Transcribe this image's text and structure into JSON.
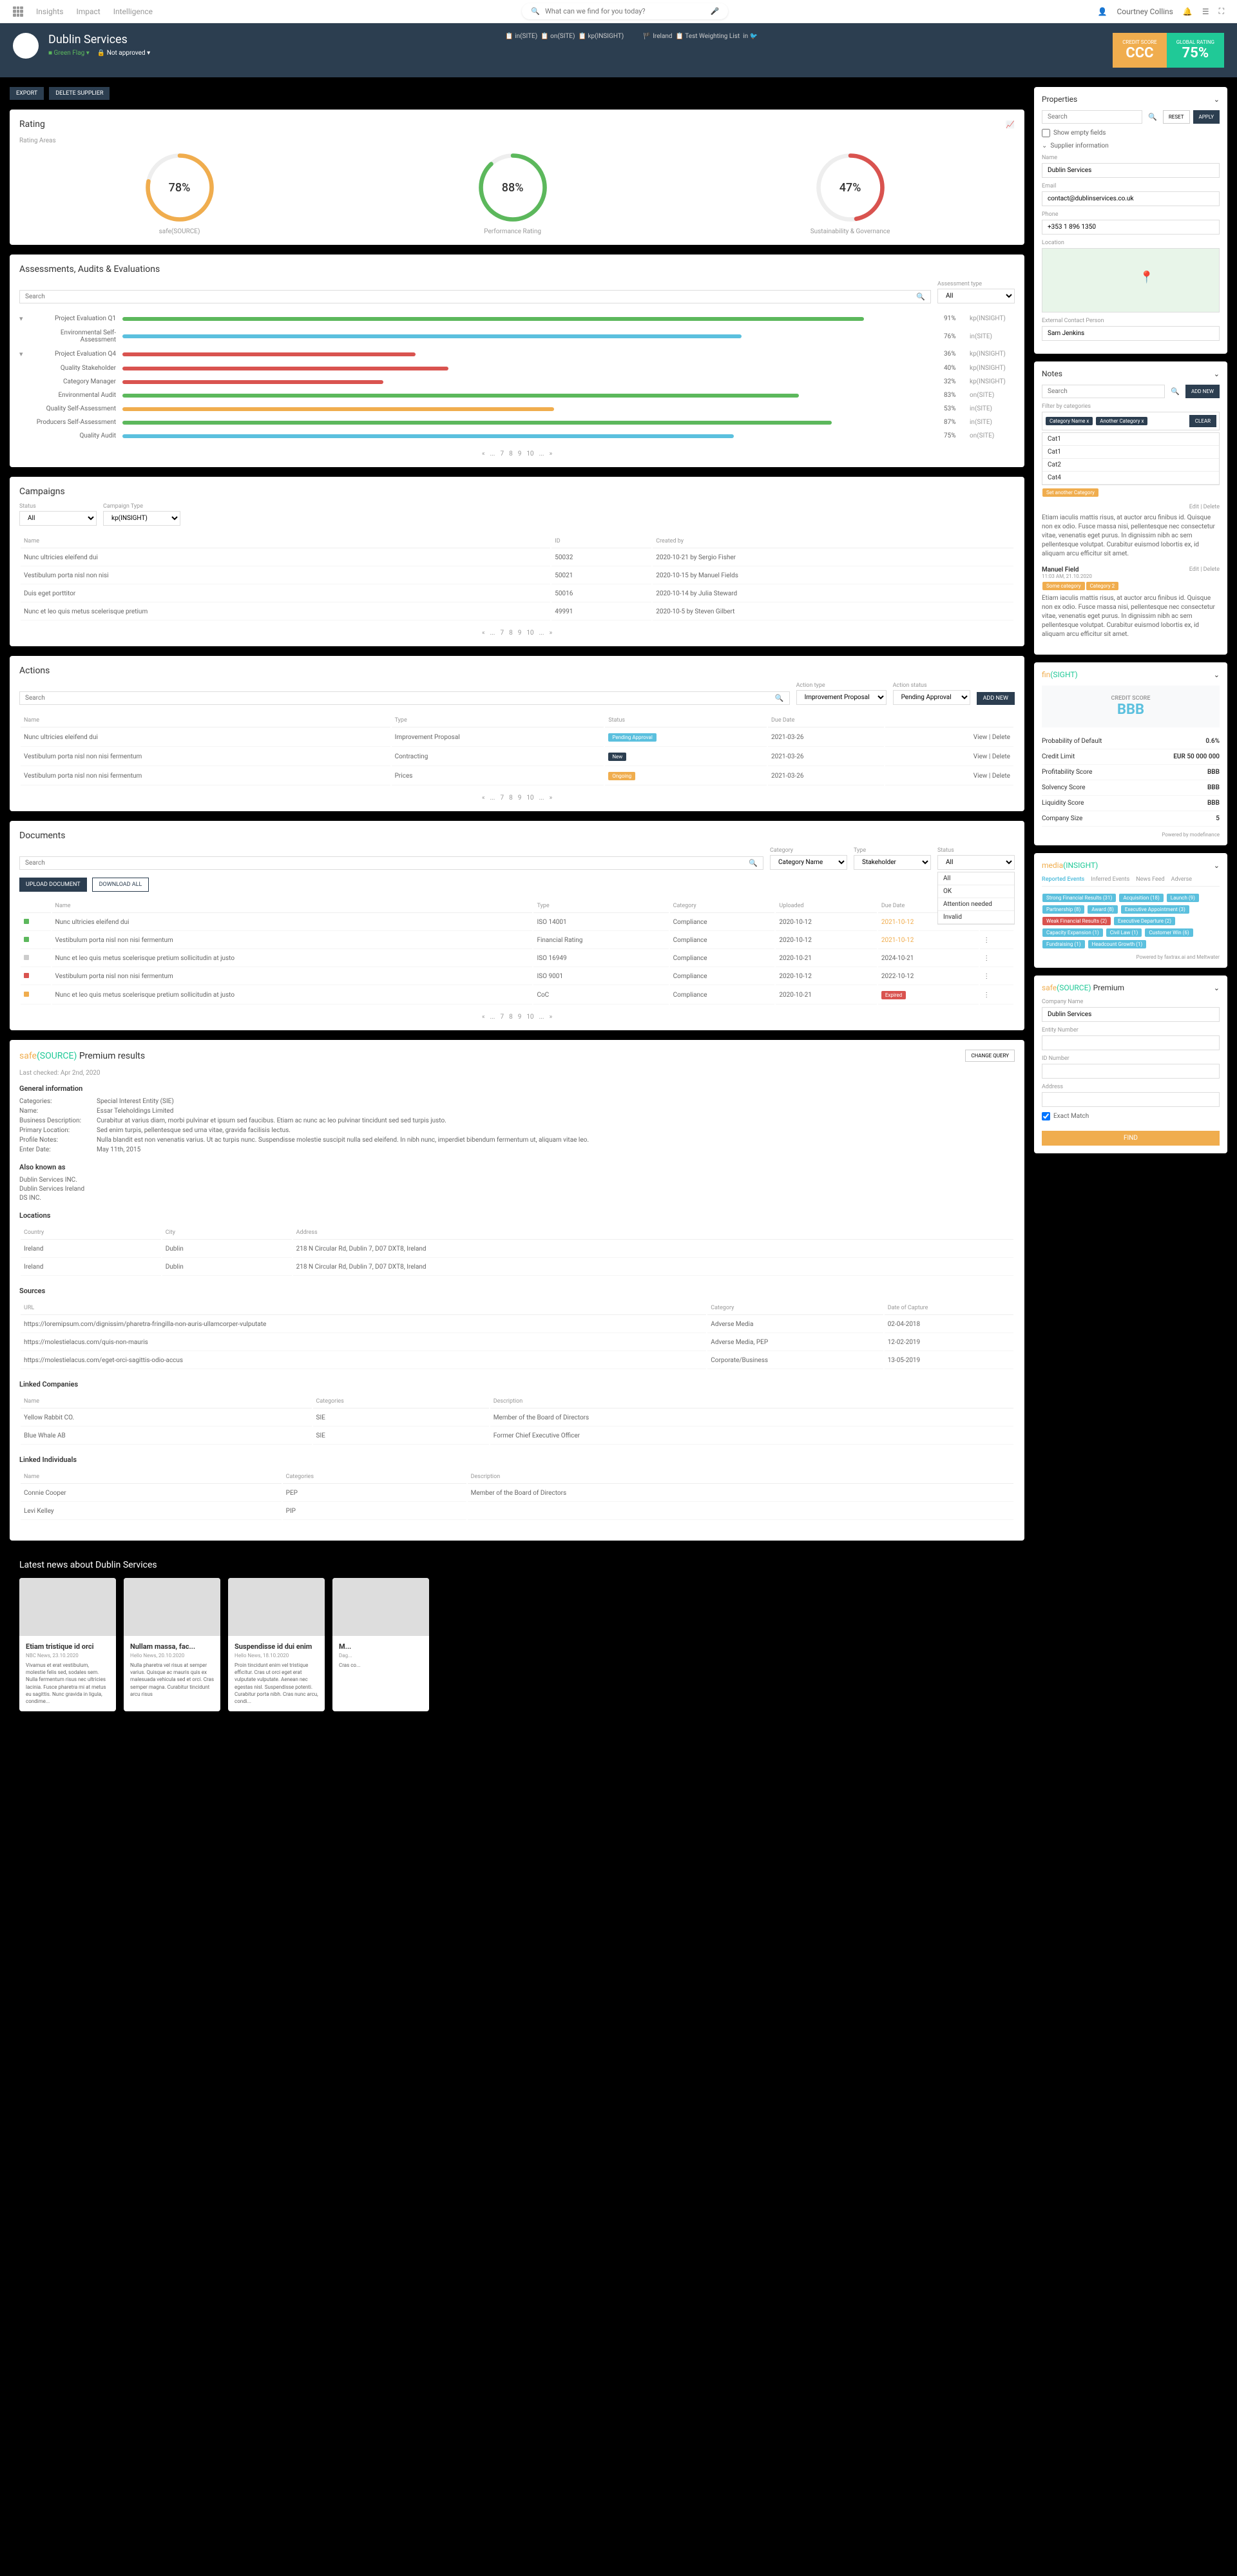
{
  "topNav": {
    "items": [
      "Insights",
      "Impact",
      "Intelligence"
    ],
    "user": "Courtney Collins",
    "searchPlaceholder": "What can we find for you today?"
  },
  "header": {
    "company": "Dublin Services",
    "flag": "Green Flag",
    "approval": "Not approved",
    "meta": [
      {
        "icon": "📋",
        "text": "in(SITE)"
      },
      {
        "icon": "📋",
        "text": "on(SITE)"
      },
      {
        "icon": "📋",
        "text": "kp(INSIGHT)"
      },
      {
        "icon": "🏴",
        "text": "Ireland"
      },
      {
        "icon": "📋",
        "text": "Test Weighting List"
      }
    ],
    "creditScore": {
      "label": "CREDIT SCORE",
      "value": "CCC"
    },
    "globalRating": {
      "label": "GLOBAL RATING",
      "value": "75%"
    }
  },
  "actionBtns": {
    "export": "EXPORT",
    "delete": "DELETE SUPPLIER"
  },
  "rating": {
    "title": "Rating",
    "subtitle": "Rating Areas",
    "gauges": [
      {
        "value": "78%",
        "label": "safe(SOURCE)",
        "pct": 78,
        "color": "#f0ad4e"
      },
      {
        "value": "88%",
        "label": "Performance Rating",
        "pct": 88,
        "color": "#5cb85c"
      },
      {
        "value": "47%",
        "label": "Sustainability & Governance",
        "pct": 47,
        "color": "#d9534f"
      }
    ]
  },
  "assessments": {
    "title": "Assessments, Audits & Evaluations",
    "typeLabel": "Assessment type",
    "typeAll": "All",
    "rows": [
      {
        "name": "Project Evaluation Q1",
        "pct": 91,
        "type": "kp(INSIGHT)",
        "color": "green",
        "expand": true
      },
      {
        "name": "Environmental Self-Assessment",
        "pct": 76,
        "type": "in(SITE)",
        "color": "blue"
      },
      {
        "name": "Project Evaluation Q4",
        "pct": 36,
        "type": "kp(INSIGHT)",
        "color": "red",
        "expand": true
      },
      {
        "name": "Quality Stakeholder",
        "pct": 40,
        "type": "kp(INSIGHT)",
        "color": "red",
        "indent": true
      },
      {
        "name": "Category Manager",
        "pct": 32,
        "type": "kp(INSIGHT)",
        "color": "red",
        "indent": true
      },
      {
        "name": "Environmental Audit",
        "pct": 83,
        "type": "on(SITE)",
        "color": "green"
      },
      {
        "name": "Quality Self-Assessment",
        "pct": 53,
        "type": "in(SITE)",
        "color": "orange"
      },
      {
        "name": "Producers Self-Assessment",
        "pct": 87,
        "type": "in(SITE)",
        "color": "green"
      },
      {
        "name": "Quality Audit",
        "pct": 75,
        "type": "on(SITE)",
        "color": "blue"
      }
    ]
  },
  "campaigns": {
    "title": "Campaigns",
    "statusLabel": "Status",
    "typeLabel": "Campaign Type",
    "all": "All",
    "kp": "kp(INSIGHT)",
    "cols": [
      "Name",
      "ID",
      "Created by"
    ],
    "rows": [
      {
        "name": "Nunc ultricies eleifend dui",
        "id": "50032",
        "created": "2020-10-21 by Sergio Fisher"
      },
      {
        "name": "Vestibulum porta nisl non nisi",
        "id": "50021",
        "created": "2020-10-15 by Manuel Fields"
      },
      {
        "name": "Duis eget porttitor",
        "id": "50016",
        "created": "2020-10-14 by Julia Steward"
      },
      {
        "name": "Nunc et leo quis metus scelerisque pretium",
        "id": "49991",
        "created": "2020-10-5 by Steven Gilbert"
      }
    ]
  },
  "actions": {
    "title": "Actions",
    "actionTypeLabel": "Action type",
    "actionType": "Improvement Proposal",
    "statusLabel": "Action status",
    "status": "Pending Approval",
    "addBtn": "ADD NEW",
    "cols": [
      "Name",
      "Type",
      "Status",
      "Due Date",
      ""
    ],
    "rows": [
      {
        "name": "Nunc ultricies eleifend dui",
        "type": "Improvement Proposal",
        "status": "Pending Approval",
        "statusClass": "blue",
        "date": "2021-03-26",
        "actions": "View | Delete"
      },
      {
        "name": "Vestibulum porta nisl non nisi fermentum",
        "type": "Contracting",
        "status": "New",
        "statusClass": "navy",
        "date": "2021-03-26",
        "actions": "View | Delete"
      },
      {
        "name": "Vestibulum porta nisl non nisi fermentum",
        "type": "Prices",
        "status": "Ongoing",
        "statusClass": "orange",
        "date": "2021-03-26",
        "actions": "View | Delete"
      }
    ]
  },
  "documents": {
    "title": "Documents",
    "catLabel": "Category",
    "cat": "Category Name",
    "typeLabel": "Type",
    "type": "Stakeholder",
    "statusLabel": "Status",
    "status": "All",
    "uploadBtn": "UPLOAD DOCUMENT",
    "downloadBtn": "DOWNLOAD ALL",
    "statusOptions": [
      "All",
      "OK",
      "Attention needed",
      "Invalid"
    ],
    "cols": [
      "",
      "Name",
      "Type",
      "Category",
      "Uploaded",
      "Due Date",
      ""
    ],
    "rows": [
      {
        "marker": "green",
        "name": "Nunc ultricies eleifend dui",
        "type": "ISO 14001",
        "cat": "Compliance",
        "up": "2020-10-12",
        "due": "2021-10-12",
        "exp": ""
      },
      {
        "marker": "green",
        "name": "Vestibulum porta nisl non nisi fermentum",
        "type": "Financial Rating",
        "cat": "Compliance",
        "up": "2020-10-12",
        "due": "2021-10-12",
        "exp": ""
      },
      {
        "marker": "gray",
        "name": "Nunc et leo quis metus scelerisque pretium sollicitudin at justo",
        "type": "ISO 16949",
        "cat": "Compliance",
        "up": "2020-10-21",
        "due": "2024-10-21",
        "exp": ""
      },
      {
        "marker": "red",
        "name": "Vestibulum porta nisl non nisi fermentum",
        "type": "ISO 9001",
        "cat": "Compliance",
        "up": "2020-10-12",
        "due": "2022-10-12",
        "exp": ""
      },
      {
        "marker": "orange",
        "name": "Nunc et leo quis metus scelerisque pretium sollicitudin at justo",
        "type": "CoC",
        "cat": "Compliance",
        "up": "2020-10-21",
        "due": "",
        "exp": "Expired"
      }
    ]
  },
  "premium": {
    "title": "safe(SOURCE) Premium results",
    "changeBtn": "CHANGE QUERY",
    "lastChecked": "Last checked: Apr 2nd, 2020",
    "general": {
      "heading": "General information",
      "rows": [
        {
          "label": "Categories:",
          "val": "Special Interest Entity (SIE)"
        },
        {
          "label": "Name:",
          "val": "Essar Teleholdings Limited"
        },
        {
          "label": "Business Description:",
          "val": "Curabitur at varius diam, morbi pulvinar et ipsum sed faucibus. Etiam ac nunc ac leo pulvinar tincidunt sed sed turpis justo."
        },
        {
          "label": "Primary Location:",
          "val": "Sed enim turpis, pellentesque sed urna vitae, gravida facilisis lectus."
        },
        {
          "label": "Profile Notes:",
          "val": "Nulla blandit est non venenatis varius. Ut ac turpis nunc. Suspendisse molestie suscipit nulla sed eleifend. In nibh nunc, imperdiet bibendum fermentum ut, aliquam vitae leo."
        },
        {
          "label": "Enter Date:",
          "val": "May 11th, 2015"
        }
      ]
    },
    "aka": {
      "heading": "Also known as",
      "items": [
        "Dublin Services INC.",
        "Dublin Services Ireland",
        "DS INC."
      ]
    },
    "locations": {
      "heading": "Locations",
      "cols": [
        "Country",
        "City",
        "Address"
      ],
      "rows": [
        {
          "c": "Ireland",
          "city": "Dublin",
          "addr": "218 N Circular Rd, Dublin 7, D07 DXT8, Ireland"
        },
        {
          "c": "Ireland",
          "city": "Dublin",
          "addr": "218 N Circular Rd, Dublin 7, D07 DXT8, Ireland"
        }
      ]
    },
    "sources": {
      "heading": "Sources",
      "cols": [
        "URL",
        "Category",
        "Date of Capture"
      ],
      "rows": [
        {
          "url": "https://loremipsum.com/dignissim/pharetra-fringilla-non-auris-ullamcorper-vulputate",
          "cat": "Adverse Media",
          "date": "02-04-2018"
        },
        {
          "url": "https://molestielacus.com/quis-non-mauris",
          "cat": "Adverse Media, PEP",
          "date": "12-02-2019"
        },
        {
          "url": "https://molestielacus.com/eget-orci-sagittis-odio-accus",
          "cat": "Corporate/Business",
          "date": "13-05-2019"
        }
      ]
    },
    "linkedCompanies": {
      "heading": "Linked Companies",
      "cols": [
        "Name",
        "Categories",
        "Description"
      ],
      "rows": [
        {
          "name": "Yellow Rabbit CO.",
          "cat": "SIE",
          "desc": "Member of the Board of Directors"
        },
        {
          "name": "Blue Whale AB",
          "cat": "SIE",
          "desc": "Former Chief Executive Officer"
        }
      ]
    },
    "linkedIndividuals": {
      "heading": "Linked Individuals",
      "cols": [
        "Name",
        "Categories",
        "Description"
      ],
      "rows": [
        {
          "name": "Connie Cooper",
          "cat": "PEP",
          "desc": "Member of the Board of Directors"
        },
        {
          "name": "Levi Kelley",
          "cat": "PIP",
          "desc": ""
        }
      ]
    }
  },
  "news": {
    "title": "Latest news about Dublin Services",
    "cards": [
      {
        "title": "Etiam tristique id orci",
        "meta": "NBC News, 23.10.2020",
        "text": "Vivamus et erat vestibulum, molestie felis sed, sodales sem. Nulla fermentum risus nec ultricies lacinia. Fusce pharetra mi at metus eu sagittis. Nunc gravida in ligula, condime..."
      },
      {
        "title": "Nullam massa, fac...",
        "meta": "Hello News, 20.10.2020",
        "text": "Nulla pharetra vel risus at semper varius. Quisque ac mauris quis ex malesuada vehicula sed et orci. Cras semper magna. Curabitur tincidunt arcu risus"
      },
      {
        "title": "Suspendisse id dui enim",
        "meta": "Hello News, 18.10.2020",
        "text": "Proin tincidunt enim vel tristique efficitur. Cras ut orci eget erat vulputate vulputate. Aenean nec egestas nisl. Suspendisse potenti. Curabitur porta nibh. Cras nunc arcu, condi..."
      },
      {
        "title": "M...",
        "meta": "Dag...",
        "text": "Cras co..."
      }
    ]
  },
  "properties": {
    "title": "Properties",
    "reset": "RESET",
    "apply": "APPLY",
    "showEmpty": "Show empty fields",
    "supplierInfo": "Supplier information",
    "name": {
      "label": "Name",
      "val": "Dublin Services"
    },
    "email": {
      "label": "Email",
      "val": "contact@dublinservices.co.uk"
    },
    "phone": {
      "label": "Phone",
      "val": "+353 1 896 1350"
    },
    "location": {
      "label": "Location"
    },
    "contactPerson": {
      "label": "External Contact Person",
      "val": "Sam Jenkins"
    }
  },
  "notes": {
    "title": "Notes",
    "addBtn": "ADD NEW",
    "filterLabel": "Filter by categories",
    "tags": [
      "Category Name x",
      "Another Category x"
    ],
    "dropdownItems": [
      "Cat1",
      "Cat1",
      "Cat2",
      "Cat4"
    ],
    "setAnother": "Set another Category",
    "clearBtn": "CLEAR",
    "items": [
      {
        "text": "Etiam iaculis mattis risus, at auctor arcu finibus id. Quisque non ex odio. Fusce massa nisi, pellentesque nec consectetur vitae, venenatis eget purus. In dignissim nibh ac sem pellentesque volutpat. Curabitur euismod lobortis ex, id aliquam arcu efficitur sit amet.",
        "actions": "Edit | Delete"
      },
      {
        "author": "Manuel Field",
        "date": "11:03 AM, 21.10.2020",
        "actions": "Edit | Delete",
        "tags": [
          "Some category",
          "Category 2"
        ],
        "text": "Etiam iaculis mattis risus, at auctor arcu finibus id. Quisque non ex odio. Fusce massa nisi, pellentesque nec consectetur vitae, venenatis eget purus. In dignissim nibh ac sem pellentesque volutpat. Curabitur euismod lobortis ex, id aliquam arcu efficitur sit amet."
      }
    ]
  },
  "finsight": {
    "title": "fin(SIGHT)",
    "creditLabel": "CREDIT SCORE",
    "creditVal": "BBB",
    "rows": [
      {
        "label": "Probability of Default",
        "val": "0.6%"
      },
      {
        "label": "Credit Limit",
        "val": "EUR 50 000 000"
      },
      {
        "label": "Profitability Score",
        "val": "BBB"
      },
      {
        "label": "Solvency Score",
        "val": "BBB"
      },
      {
        "label": "Liquidity Score",
        "val": "BBB"
      },
      {
        "label": "Company Size",
        "val": "5"
      }
    ],
    "powered": "Powered by modefinance"
  },
  "media": {
    "title": "media(INSIGHT)",
    "tabs": [
      "Reported Events",
      "Inferred Events",
      "News Feed",
      "Adverse"
    ],
    "events": [
      {
        "text": "Strong Financial Results (31)",
        "c": "blue"
      },
      {
        "text": "Acquisition (18)",
        "c": "blue"
      },
      {
        "text": "Launch (9)",
        "c": "blue"
      },
      {
        "text": "Partnership (8)",
        "c": "blue"
      },
      {
        "text": "Award (8)",
        "c": "blue"
      },
      {
        "text": "Executive Appointment (3)",
        "c": "blue"
      },
      {
        "text": "Weak Financial Results (2)",
        "c": "red"
      },
      {
        "text": "Executive Departure (2)",
        "c": "blue"
      },
      {
        "text": "Capacity Expansion (1)",
        "c": "blue"
      },
      {
        "text": "Civil Law (1)",
        "c": "blue"
      },
      {
        "text": "Customer Win (6)",
        "c": "blue"
      },
      {
        "text": "Fundraising (1)",
        "c": "blue"
      },
      {
        "text": "Headcount Growth (1)",
        "c": "blue"
      }
    ],
    "powered": "Powered by faxtrax.ai and Meltwater"
  },
  "safeSource": {
    "title": "safe(SOURCE) Premium",
    "company": "Company Name",
    "companyVal": "Dublin Services",
    "entity": "Entity Number",
    "id": "ID Number",
    "address": "Address",
    "exact": "Exact Match",
    "findBtn": "FIND"
  },
  "pagination": [
    "«",
    "...",
    "7",
    "8",
    "9",
    "10",
    "...",
    "»"
  ]
}
